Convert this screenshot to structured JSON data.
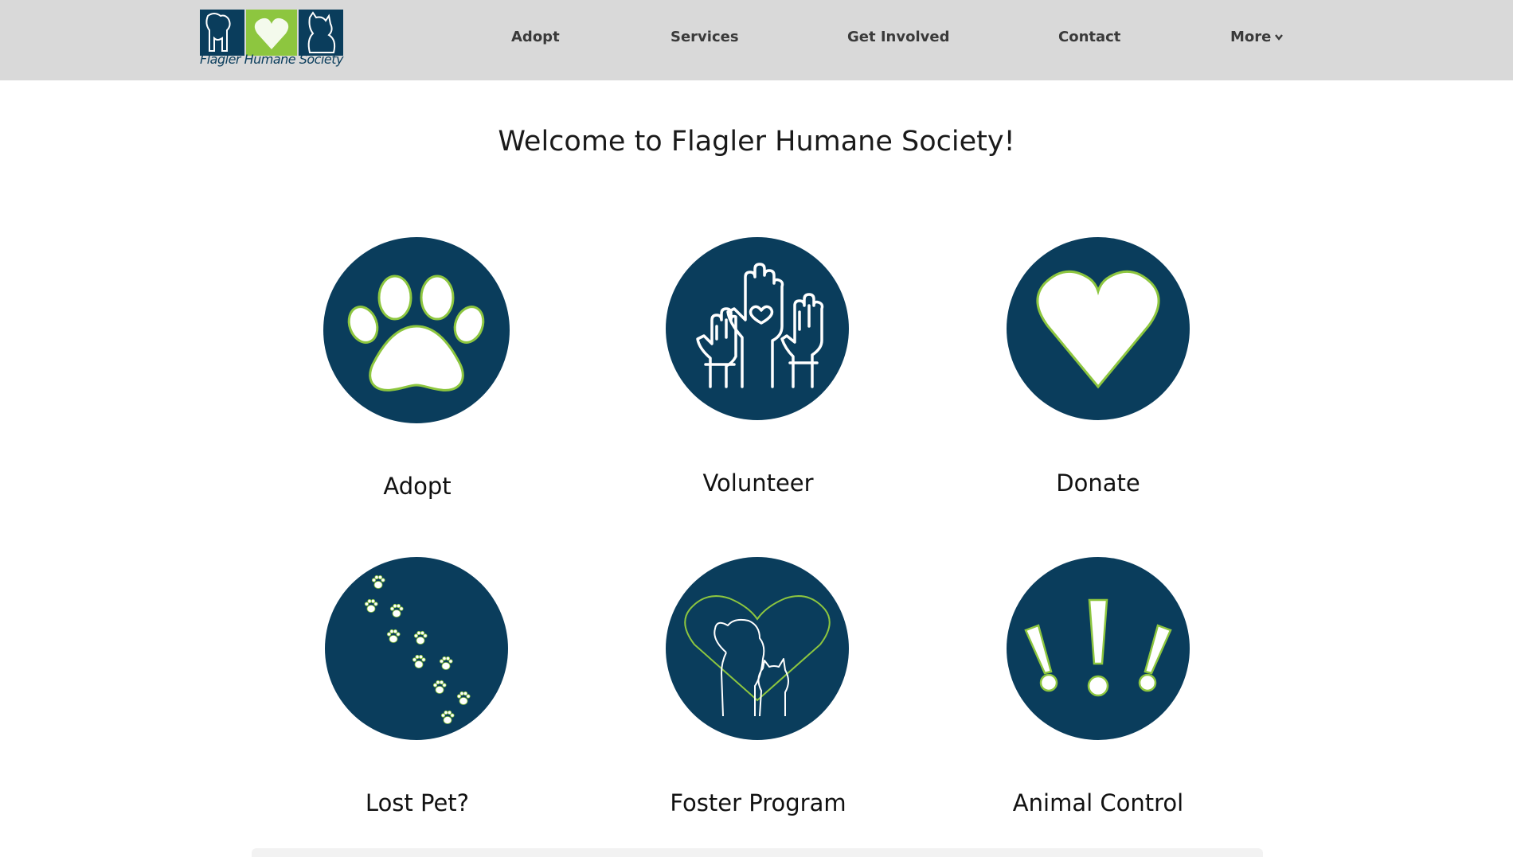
{
  "brand": {
    "name": "Flagler Humane Society",
    "navy": "#0a3d5c",
    "green": "#8dc63f",
    "header_bg": "#d9d9d9"
  },
  "nav": {
    "items": [
      {
        "label": "Adopt"
      },
      {
        "label": "Services"
      },
      {
        "label": "Get Involved"
      },
      {
        "label": "Contact"
      },
      {
        "label": "More"
      }
    ],
    "more_icon": "chevron-down-icon"
  },
  "main": {
    "welcome": "Welcome to Flagler Humane Society!",
    "tiles": [
      {
        "label": "Adopt",
        "icon": "paw-icon"
      },
      {
        "label": "Volunteer",
        "icon": "raised-hands-icon"
      },
      {
        "label": "Donate",
        "icon": "heart-icon"
      },
      {
        "label": "Lost Pet?",
        "icon": "paw-prints-trail-icon"
      },
      {
        "label": "Foster Program",
        "icon": "dog-cat-heart-icon"
      },
      {
        "label": "Animal Control",
        "icon": "exclamation-marks-icon"
      }
    ]
  }
}
